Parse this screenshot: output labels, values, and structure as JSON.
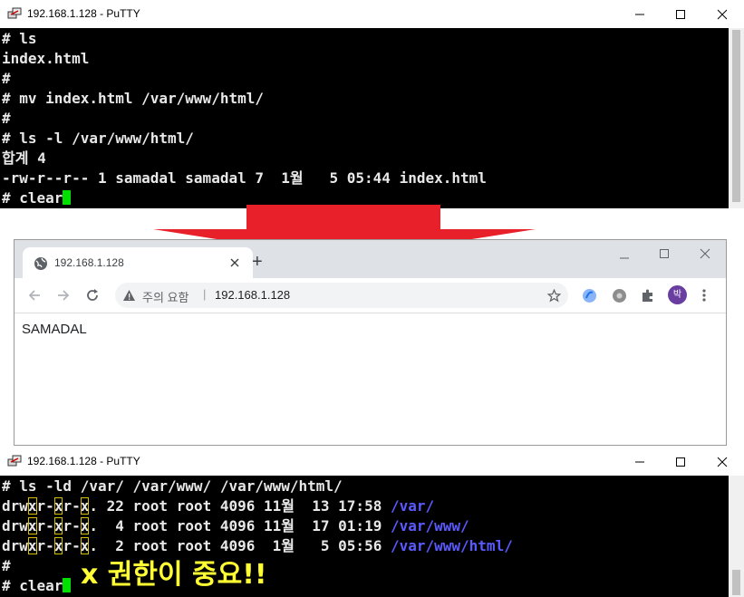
{
  "top_window": {
    "title": "192.168.1.128 - PuTTY",
    "lines": [
      "# ls",
      "index.html",
      "#",
      "# mv index.html /var/www/html/",
      "#",
      "# ls -l /var/www/html/",
      "합계 4",
      "-rw-r--r-- 1 samadal samadal 7  1월   5 05:44 index.html",
      "# clear"
    ]
  },
  "browser": {
    "tab_title": "192.168.1.128",
    "new_tab_symbol": "+",
    "security_label": "주의 요함",
    "separator": "|",
    "url": "192.168.1.128",
    "profile_initial": "박",
    "page_text": "SAMADAL"
  },
  "bottom_window": {
    "title": "192.168.1.128 - PuTTY",
    "command": "# ls -ld /var/ /var/www/ /var/www/html/",
    "rows": [
      {
        "d": "d",
        "rw": "rw",
        "x1": "x",
        "r1": "r-",
        "x2": "x",
        "r2": "r-",
        "x3": "x",
        "rest": ". 22 root root 4096 11월  13 17:58 ",
        "path": "/var/"
      },
      {
        "d": "d",
        "rw": "rw",
        "x1": "x",
        "r1": "r-",
        "x2": "x",
        "r2": "r-",
        "x3": "x",
        "rest": ".  4 root root 4096 11월  17 01:19 ",
        "path": "/var/www/"
      },
      {
        "d": "d",
        "rw": "rw",
        "x1": "x",
        "r1": "r-",
        "x2": "x",
        "r2": "r-",
        "x3": "x",
        "rest": ".  2 root root 4096  1월   5 05:56 ",
        "path": "/var/www/html/"
      }
    ],
    "prompt_line": "#",
    "clear_line": "# clear",
    "annotation": "x 권한이 중요!!"
  },
  "colors": {
    "terminal_bg": "#000000",
    "terminal_fg": "#e8e8e8",
    "cursor": "#00e000",
    "dir_blue": "#5a5aff",
    "highlight_box": "#d8c000",
    "arrow_red": "#e8202a",
    "annotation_yellow": "#ffff33"
  }
}
